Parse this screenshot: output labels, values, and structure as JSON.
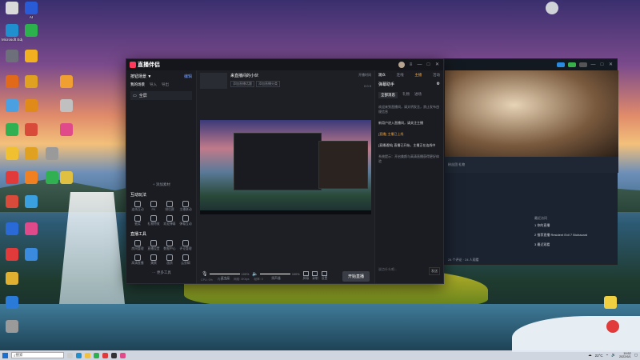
{
  "desktop_icons": [
    {
      "caption": "",
      "color": "#d9d9d9"
    },
    {
      "caption": "AI",
      "color": "#2a5bd7"
    },
    {
      "caption": "Microsoft Edge",
      "color": "#1f8fce"
    },
    {
      "caption": "",
      "color": "#2bb24c"
    },
    {
      "caption": "",
      "color": "#6d6f7a"
    },
    {
      "caption": "",
      "color": "#f0b020"
    },
    {
      "caption": "",
      "color": "#e06a1a"
    },
    {
      "caption": "",
      "color": "#e0a020"
    },
    {
      "caption": "",
      "color": "#f0a030"
    },
    {
      "caption": "",
      "color": "#4aa0e0"
    },
    {
      "caption": "",
      "color": "#e08a1a"
    },
    {
      "caption": "",
      "color": "#c0c0c0"
    },
    {
      "caption": "",
      "color": "#30b050"
    },
    {
      "caption": "",
      "color": "#d84a3a"
    },
    {
      "caption": "",
      "color": "#e04a8a"
    },
    {
      "caption": "",
      "color": "#f0c030"
    },
    {
      "caption": "",
      "color": "#e0a020"
    },
    {
      "caption": "",
      "color": "#9a9a9a"
    },
    {
      "caption": "",
      "color": "#e03a3a"
    },
    {
      "caption": "",
      "color": "#f08020"
    },
    {
      "caption": "",
      "color": "#e0c040"
    },
    {
      "caption": "",
      "color": "#d84a3a"
    },
    {
      "caption": "",
      "color": "#3aa0e0"
    },
    {
      "caption": "",
      "color": "#30b050"
    },
    {
      "caption": "",
      "color": "#2a6ad7"
    },
    {
      "caption": "",
      "color": "#e04a8a"
    },
    {
      "caption": "",
      "color": "#e03a3a"
    },
    {
      "caption": "",
      "color": "#3a8ae0"
    },
    {
      "caption": "",
      "color": "#e0b030"
    },
    {
      "caption": "",
      "color": "#2a7ad7"
    },
    {
      "caption": "",
      "color": "#9a9a9a"
    }
  ],
  "app": {
    "brand": "直播伴侣",
    "version": "",
    "scenes_header": "按钮场景 ▼",
    "scenes_link": "编辑",
    "scenes_link2": "设置",
    "scene_tabs": [
      "我的场景",
      "导入",
      "导出"
    ],
    "scene_item": "全屏",
    "add_scene": "+ 添加素材",
    "tools_title_1": "互动玩法",
    "tools_title_2": "直播工具",
    "tools_1": [
      "连线互动",
      "PK",
      "排位赛",
      "主播联动",
      "抽奖",
      "礼物特效",
      "欢迎弹幕",
      "弹幕互动"
    ],
    "tools_2": [
      "房间管理",
      "直播设置",
      "数据中心",
      "评论管理",
      "高清直播",
      "美颜",
      "画质",
      "云剪辑"
    ],
    "more_tools": "··· 更多工具",
    "stream_title": "来直播间的小伙",
    "stream_tags": [
      "添加直播话题",
      "添加直播分类"
    ],
    "stream_right_1": "开播时间",
    "stream_right_2": "0 0 0",
    "mic_label": "麦克风",
    "mic_value": "100%",
    "mic_level": 1.0,
    "speaker_label": "扬声器",
    "speaker_value": "100%",
    "speaker_level": 1.0,
    "ctl_1": "屏幕",
    "ctl_2": "录制",
    "ctl_3": "设置",
    "start_button": "开始直播",
    "status_items": [
      "CPU: 0%",
      "内存: 0%",
      "网络: 0Kbps",
      "帧率: 0"
    ],
    "right_tabs": [
      "观众",
      "连线",
      "主播",
      "活动",
      "弹幕"
    ],
    "right_title": "弹幕助手",
    "right_sub": [
      "全部消息",
      "礼物",
      "进场"
    ],
    "right_msgs": [
      "欢迎来到直播间，请文明发言，禁止发布违规信息",
      "新用户进入直播间，请关注主播",
      "[直播通知] 直播已开始，主播正在连线中",
      "系统提示：开启美颜与高清直播获得更好体验"
    ],
    "right_highlight": "[直播] 主播已上线",
    "right_bottom": "发送",
    "right_bottom_hint": "说点什么吧..."
  },
  "bgwindow": {
    "bar_text": "粉丝团 礼物",
    "side_header": "最近访问",
    "side_rows": [
      "1 你的直播",
      "2 推荐直播 Resident Evil 7 Biohazard",
      "3 最近观看"
    ],
    "bottom_text": "24 个评论 · 24 人观看"
  },
  "taskbar": {
    "search": "搜索",
    "weather": "22°C",
    "time": "19:52",
    "date": "2022/6/1"
  }
}
